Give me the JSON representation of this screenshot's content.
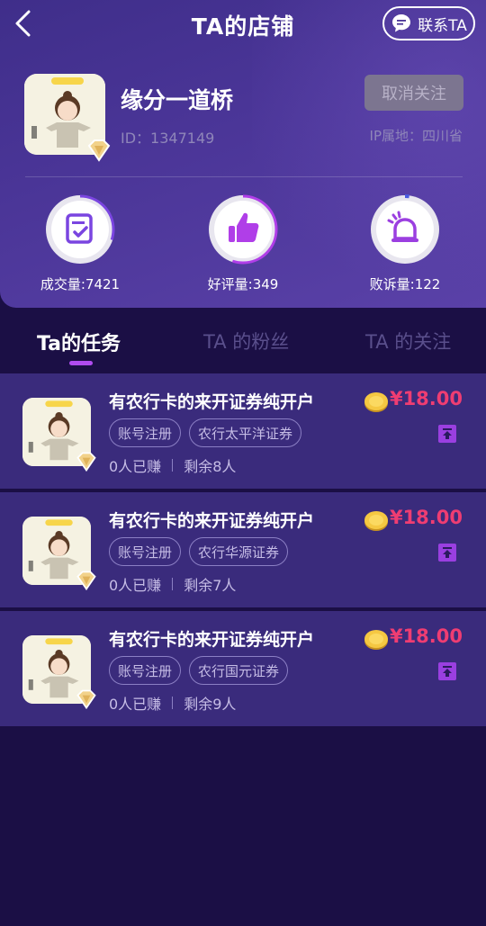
{
  "header": {
    "title": "TA的店铺",
    "contact_label": "联系TA"
  },
  "shop": {
    "name": "缘分一道桥",
    "id_text": "ID：1347149",
    "unfollow_label": "取消关注",
    "ip_text": "IP属地：四川省"
  },
  "stats": [
    {
      "label": "成交量:7421",
      "icon": "document-check-icon",
      "progress": 0.3
    },
    {
      "label": "好评量:349",
      "icon": "thumbs-up-icon",
      "progress": 0.55
    },
    {
      "label": "败诉量:122",
      "icon": "alarm-bell-icon",
      "progress": 0.02
    }
  ],
  "tabs": [
    {
      "label": "Ta的任务",
      "active": true
    },
    {
      "label": "TA 的粉丝",
      "active": false
    },
    {
      "label": "TA 的关注",
      "active": false
    }
  ],
  "tasks": [
    {
      "title": "有农行卡的来开证券纯开户",
      "tags": [
        "账号注册",
        "农行太平洋证券"
      ],
      "earned": "0人已赚",
      "remaining": "剩余8人",
      "price": "¥18.00"
    },
    {
      "title": "有农行卡的来开证券纯开户",
      "tags": [
        "账号注册",
        "农行华源证券"
      ],
      "earned": "0人已赚",
      "remaining": "剩余7人",
      "price": "¥18.00"
    },
    {
      "title": "有农行卡的来开证券纯开户",
      "tags": [
        "账号注册",
        "农行国元证券"
      ],
      "earned": "0人已赚",
      "remaining": "剩余9人",
      "price": "¥18.00"
    }
  ],
  "colors": {
    "background": "#1b0f45",
    "header": "#4a3597",
    "card": "#3a2b7c",
    "price": "#ef3d72",
    "accent": "#b04cf0"
  }
}
